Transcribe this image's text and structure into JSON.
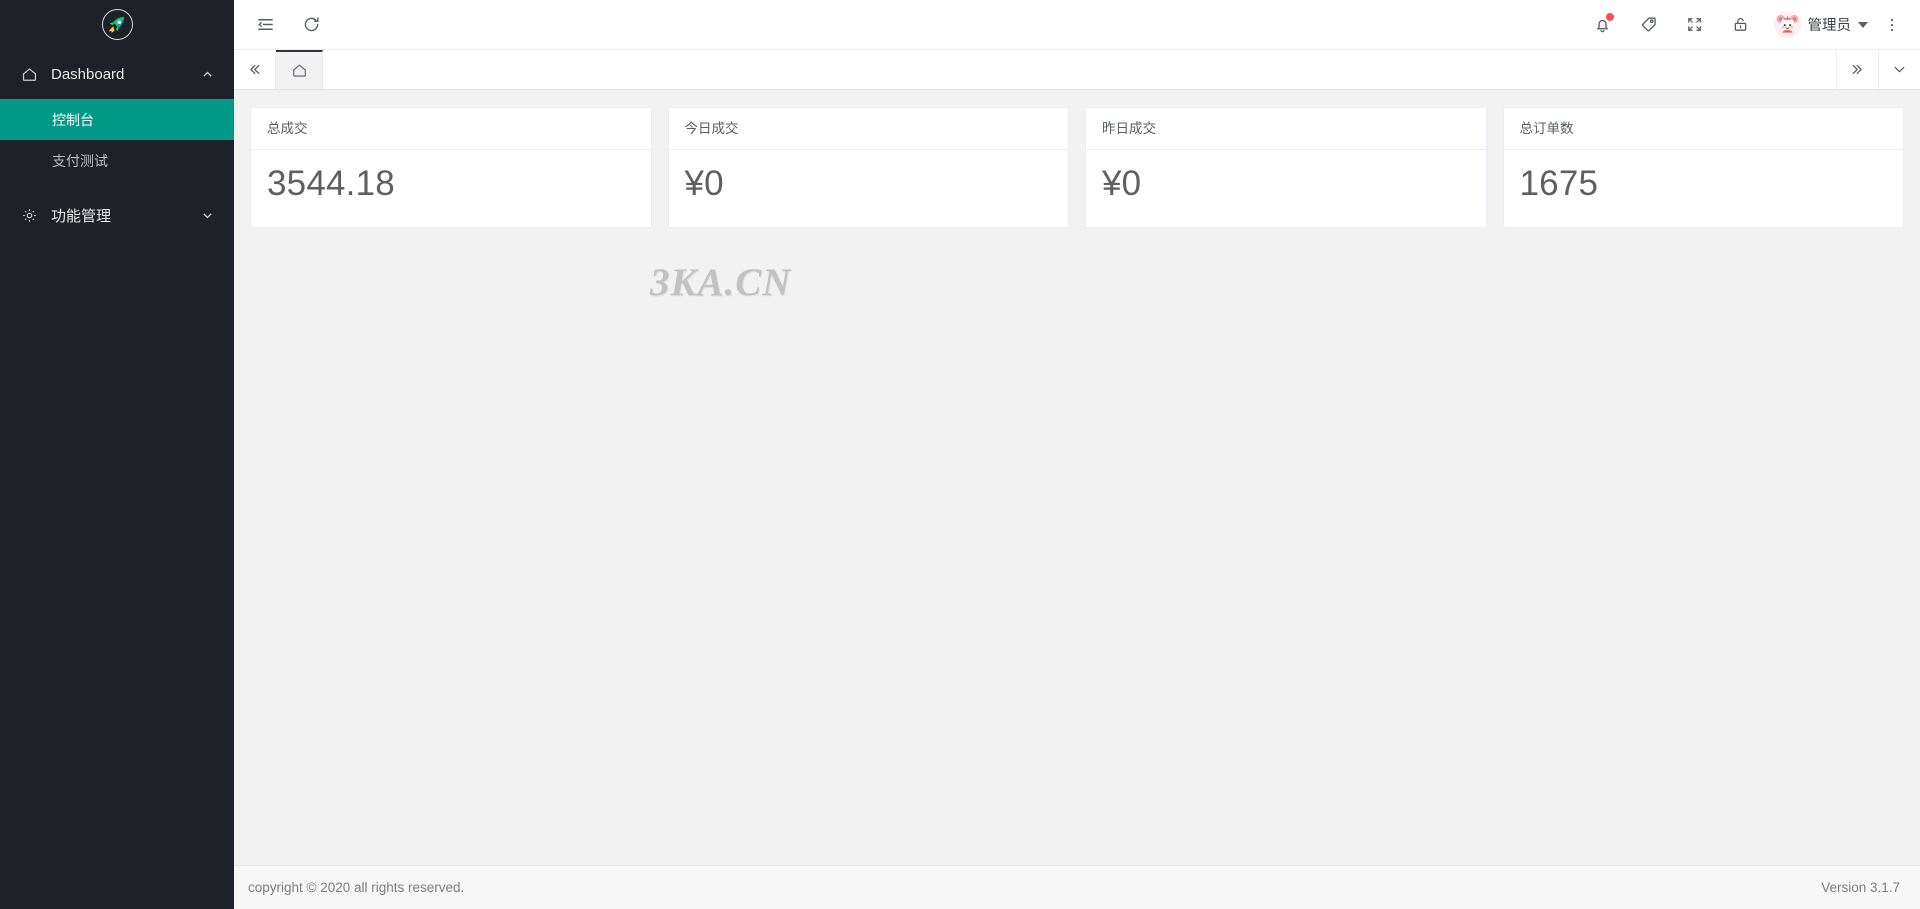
{
  "sidebar": {
    "logo_icon": "rocket-logo-icon",
    "groups": [
      {
        "icon": "home-icon",
        "label": "Dashboard",
        "arrow": "chevron-up-icon",
        "expanded": true,
        "items": [
          {
            "label": "控制台",
            "active": true
          },
          {
            "label": "支付测试",
            "active": false
          }
        ]
      },
      {
        "icon": "gear-icon",
        "label": "功能管理",
        "arrow": "chevron-down-icon",
        "expanded": false,
        "items": []
      }
    ]
  },
  "header": {
    "left_icons": [
      {
        "name": "menu-fold-icon",
        "label": "折叠菜单"
      },
      {
        "name": "refresh-icon",
        "label": "刷新"
      }
    ],
    "right_icons": [
      {
        "name": "bell-icon",
        "label": "通知",
        "badge": true
      },
      {
        "name": "tag-icon",
        "label": "标签",
        "badge": false
      },
      {
        "name": "fullscreen-icon",
        "label": "全屏",
        "badge": false
      },
      {
        "name": "lock-icon",
        "label": "锁屏",
        "badge": false
      }
    ],
    "user": {
      "avatar": "user-avatar-mascot",
      "name": "管理员",
      "caret": "caret-down-icon"
    },
    "more_icon": "more-vertical-icon"
  },
  "tabsbar": {
    "prev_icon": "double-chevron-left-icon",
    "next_icon": "double-chevron-right-icon",
    "dropdown_icon": "chevron-down-icon",
    "tabs": [
      {
        "icon": "home-icon",
        "label": "",
        "active": true
      }
    ]
  },
  "content": {
    "cards": [
      {
        "title": "总成交",
        "value": "3544.18"
      },
      {
        "title": "今日成交",
        "value": "¥0"
      },
      {
        "title": "昨日成交",
        "value": "¥0"
      },
      {
        "title": "总订单数",
        "value": "1675"
      }
    ],
    "watermark": "3KA.CN"
  },
  "footer": {
    "copyright": "copyright © 2020 all rights reserved.",
    "version": "Version 3.1.7"
  },
  "colors": {
    "sidebar_bg": "#1f2129",
    "sidebar_active": "#009a87",
    "page_bg": "#f2f2f2",
    "card_bg": "#ffffff",
    "badge_red": "#ff4d4f",
    "tab_active_border": "#2f3542"
  }
}
